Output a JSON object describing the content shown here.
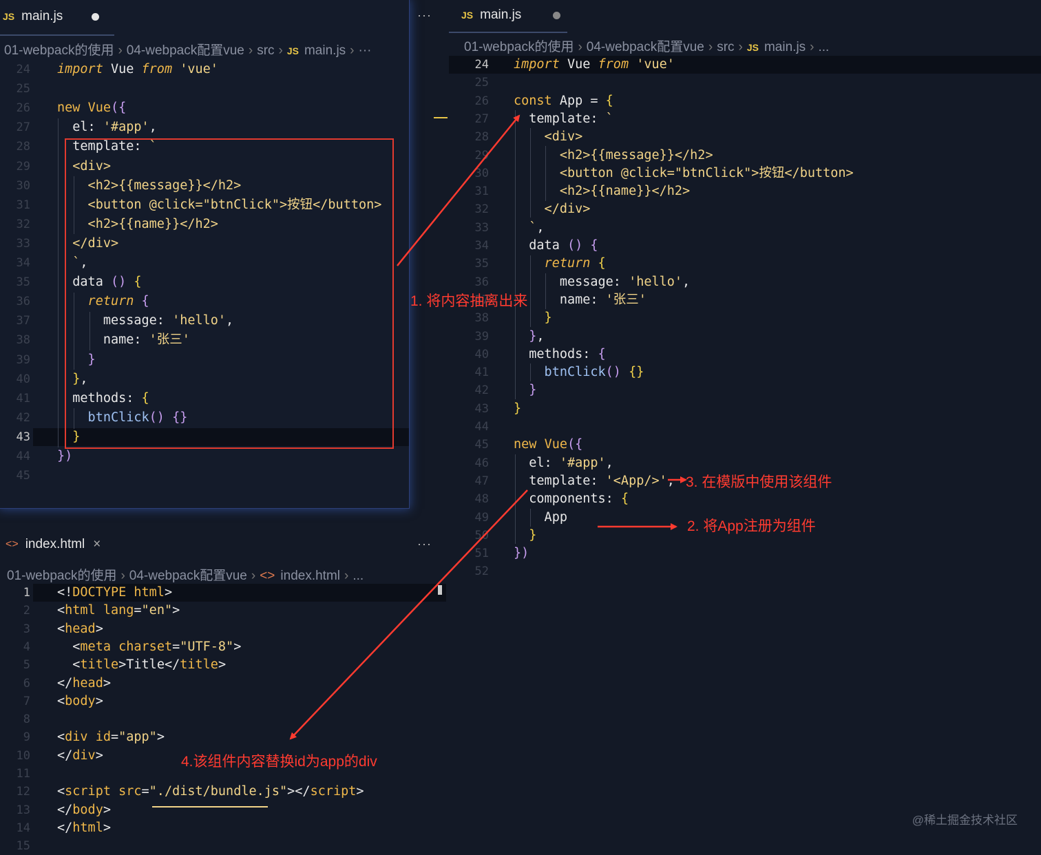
{
  "left_editor": {
    "tab": {
      "icon": "JS",
      "label": "main.js"
    },
    "more": "···",
    "breadcrumb": {
      "folder1": "01-webpack的使用",
      "folder2": "04-webpack配置vue",
      "folder3": "src",
      "icon": "JS",
      "file": "main.js",
      "tail": "···"
    }
  },
  "right_editor": {
    "tab": {
      "icon": "JS",
      "label": "main.js"
    },
    "breadcrumb": {
      "folder1": "01-webpack的使用",
      "folder2": "04-webpack配置vue",
      "folder3": "src",
      "icon": "JS",
      "file": "main.js",
      "tail": "..."
    }
  },
  "index_editor": {
    "tab": {
      "icon": "<>",
      "label": "index.html",
      "close": "×"
    },
    "more": "···",
    "breadcrumb": {
      "folder1": "01-webpack的使用",
      "folder2": "04-webpack配置vue",
      "icon": "<>",
      "file": "index.html",
      "tail": "..."
    }
  },
  "annotations": {
    "a1": "1. 将内容抽离出来",
    "a2": "2. 将App注册为组件",
    "a3": "3. 在模版中使用该组件",
    "a4": "4.该组件内容替换id为app的div"
  },
  "watermark": "@稀土掘金技术社区",
  "left_code": [
    {
      "n": "24",
      "t": [
        [
          "k-i",
          "import"
        ],
        [
          "w",
          " Vue "
        ],
        [
          "k-i",
          "from"
        ],
        [
          "w",
          " "
        ],
        [
          "s",
          "'vue'"
        ]
      ]
    },
    {
      "n": "25",
      "t": []
    },
    {
      "n": "26",
      "t": [
        [
          "k",
          "new"
        ],
        [
          "w",
          " "
        ],
        [
          "fn",
          "Vue"
        ],
        [
          "pb",
          "({"
        ]
      ]
    },
    {
      "n": "27",
      "t": [
        [
          "w",
          "  el: "
        ],
        [
          "s",
          "'#app'"
        ],
        [
          "w",
          ","
        ]
      ]
    },
    {
      "n": "28",
      "t": [
        [
          "w",
          "  template: "
        ],
        [
          "s",
          "`"
        ]
      ]
    },
    {
      "n": "29",
      "t": [
        [
          "s",
          "  <div>"
        ]
      ]
    },
    {
      "n": "30",
      "t": [
        [
          "s",
          "    <h2>{{message}}</h2>"
        ]
      ]
    },
    {
      "n": "31",
      "t": [
        [
          "s",
          "    <button @click=\"btnClick\">按钮</button>"
        ]
      ]
    },
    {
      "n": "32",
      "t": [
        [
          "s",
          "    <h2>{{name}}</h2>"
        ]
      ]
    },
    {
      "n": "33",
      "t": [
        [
          "s",
          "  </div>"
        ]
      ]
    },
    {
      "n": "34",
      "t": [
        [
          "s",
          "  `"
        ],
        [
          "w",
          ","
        ]
      ]
    },
    {
      "n": "35",
      "t": [
        [
          "w",
          "  data "
        ],
        [
          "pb",
          "()"
        ],
        [
          "w",
          " "
        ],
        [
          "py",
          "{"
        ]
      ]
    },
    {
      "n": "36",
      "t": [
        [
          "k-i",
          "    return"
        ],
        [
          "w",
          " "
        ],
        [
          "pb",
          "{"
        ]
      ]
    },
    {
      "n": "37",
      "t": [
        [
          "w",
          "      message: "
        ],
        [
          "s",
          "'hello'"
        ],
        [
          "w",
          ","
        ]
      ]
    },
    {
      "n": "38",
      "t": [
        [
          "w",
          "      name: "
        ],
        [
          "s",
          "'张三'"
        ]
      ]
    },
    {
      "n": "39",
      "t": [
        [
          "pb",
          "    }"
        ]
      ]
    },
    {
      "n": "40",
      "t": [
        [
          "py",
          "  }"
        ],
        [
          "w",
          ","
        ]
      ]
    },
    {
      "n": "41",
      "t": [
        [
          "w",
          "  methods: "
        ],
        [
          "py",
          "{"
        ]
      ]
    },
    {
      "n": "42",
      "t": [
        [
          "mth",
          "    btnClick"
        ],
        [
          "pb",
          "()"
        ],
        [
          "w",
          " "
        ],
        [
          "pb",
          "{}"
        ]
      ]
    },
    {
      "n": "43",
      "t": [
        [
          "py",
          "  }"
        ]
      ]
    },
    {
      "n": "44",
      "t": [
        [
          "pb",
          "})"
        ]
      ]
    },
    {
      "n": "45",
      "t": []
    }
  ],
  "right_code": [
    {
      "n": "24",
      "t": [
        [
          "k-i",
          "import"
        ],
        [
          "w",
          " Vue "
        ],
        [
          "k-i",
          "from"
        ],
        [
          "w",
          " "
        ],
        [
          "s",
          "'vue'"
        ]
      ]
    },
    {
      "n": "25",
      "t": []
    },
    {
      "n": "26",
      "t": [
        [
          "k",
          "const"
        ],
        [
          "w",
          " App = "
        ],
        [
          "py",
          "{"
        ]
      ]
    },
    {
      "n": "27",
      "t": [
        [
          "w",
          "  template: "
        ],
        [
          "s",
          "`"
        ]
      ]
    },
    {
      "n": "28",
      "t": [
        [
          "s",
          "    <div>"
        ]
      ]
    },
    {
      "n": "29",
      "t": [
        [
          "s",
          "      <h2>{{message}}</h2>"
        ]
      ]
    },
    {
      "n": "30",
      "t": [
        [
          "s",
          "      <button @click=\"btnClick\">按钮</button>"
        ]
      ]
    },
    {
      "n": "31",
      "t": [
        [
          "s",
          "      <h2>{{name}}</h2>"
        ]
      ]
    },
    {
      "n": "32",
      "t": [
        [
          "s",
          "    </div>"
        ]
      ]
    },
    {
      "n": "33",
      "t": [
        [
          "s",
          "  `"
        ],
        [
          "w",
          ","
        ]
      ]
    },
    {
      "n": "34",
      "t": [
        [
          "w",
          "  data "
        ],
        [
          "pb",
          "()"
        ],
        [
          "w",
          " "
        ],
        [
          "pb",
          "{"
        ]
      ]
    },
    {
      "n": "35",
      "t": [
        [
          "k-i",
          "    return"
        ],
        [
          "w",
          " "
        ],
        [
          "py",
          "{"
        ]
      ]
    },
    {
      "n": "36",
      "t": [
        [
          "w",
          "      message: "
        ],
        [
          "s",
          "'hello'"
        ],
        [
          "w",
          ","
        ]
      ]
    },
    {
      "n": "37",
      "t": [
        [
          "w",
          "      name: "
        ],
        [
          "s",
          "'张三'"
        ]
      ]
    },
    {
      "n": "38",
      "t": [
        [
          "py",
          "    }"
        ]
      ]
    },
    {
      "n": "39",
      "t": [
        [
          "pb",
          "  }"
        ],
        [
          "w",
          ","
        ]
      ]
    },
    {
      "n": "40",
      "t": [
        [
          "w",
          "  methods: "
        ],
        [
          "pb",
          "{"
        ]
      ]
    },
    {
      "n": "41",
      "t": [
        [
          "mth",
          "    btnClick"
        ],
        [
          "pb",
          "()"
        ],
        [
          "w",
          " "
        ],
        [
          "py",
          "{}"
        ]
      ]
    },
    {
      "n": "42",
      "t": [
        [
          "pb",
          "  }"
        ]
      ]
    },
    {
      "n": "43",
      "t": [
        [
          "py",
          "}"
        ]
      ]
    },
    {
      "n": "44",
      "t": []
    },
    {
      "n": "45",
      "t": [
        [
          "k",
          "new"
        ],
        [
          "w",
          " "
        ],
        [
          "fn",
          "Vue"
        ],
        [
          "pb",
          "({"
        ]
      ]
    },
    {
      "n": "46",
      "t": [
        [
          "w",
          "  el: "
        ],
        [
          "s",
          "'#app'"
        ],
        [
          "w",
          ","
        ]
      ]
    },
    {
      "n": "47",
      "t": [
        [
          "w",
          "  template: "
        ],
        [
          "s",
          "'<App/>'"
        ],
        [
          "w",
          ","
        ]
      ]
    },
    {
      "n": "48",
      "t": [
        [
          "w",
          "  components: "
        ],
        [
          "py",
          "{"
        ]
      ]
    },
    {
      "n": "49",
      "t": [
        [
          "w",
          "    App"
        ]
      ]
    },
    {
      "n": "50",
      "t": [
        [
          "py",
          "  }"
        ]
      ]
    },
    {
      "n": "51",
      "t": [
        [
          "pb",
          "})"
        ]
      ]
    },
    {
      "n": "52",
      "t": []
    }
  ],
  "index_code": [
    {
      "n": "1",
      "t": [
        [
          "w",
          "<!"
        ],
        [
          "tagc",
          "DOCTYPE"
        ],
        [
          "w",
          " "
        ],
        [
          "attr",
          "html"
        ],
        [
          "w",
          ">"
        ]
      ]
    },
    {
      "n": "2",
      "t": [
        [
          "w",
          "<"
        ],
        [
          "tagc",
          "html"
        ],
        [
          "w",
          " "
        ],
        [
          "attr",
          "lang"
        ],
        [
          "w",
          "="
        ],
        [
          "s",
          "\"en\""
        ],
        [
          "w",
          ">"
        ]
      ]
    },
    {
      "n": "3",
      "t": [
        [
          "w",
          "<"
        ],
        [
          "tagc",
          "head"
        ],
        [
          "w",
          ">"
        ]
      ]
    },
    {
      "n": "4",
      "t": [
        [
          "w",
          "  <"
        ],
        [
          "tagc",
          "meta"
        ],
        [
          "w",
          " "
        ],
        [
          "attr",
          "charset"
        ],
        [
          "w",
          "="
        ],
        [
          "s",
          "\"UTF-8\""
        ],
        [
          "w",
          ">"
        ]
      ]
    },
    {
      "n": "5",
      "t": [
        [
          "w",
          "  <"
        ],
        [
          "tagc",
          "title"
        ],
        [
          "w",
          ">Title</"
        ],
        [
          "tagc",
          "title"
        ],
        [
          "w",
          ">"
        ]
      ]
    },
    {
      "n": "6",
      "t": [
        [
          "w",
          "</"
        ],
        [
          "tagc",
          "head"
        ],
        [
          "w",
          ">"
        ]
      ]
    },
    {
      "n": "7",
      "t": [
        [
          "w",
          "<"
        ],
        [
          "tagc",
          "body"
        ],
        [
          "w",
          ">"
        ]
      ]
    },
    {
      "n": "8",
      "t": []
    },
    {
      "n": "9",
      "t": [
        [
          "w",
          "<"
        ],
        [
          "tagc",
          "div"
        ],
        [
          "w",
          " "
        ],
        [
          "attr",
          "id"
        ],
        [
          "w",
          "="
        ],
        [
          "s",
          "\"app\""
        ],
        [
          "w",
          ">"
        ]
      ]
    },
    {
      "n": "10",
      "t": [
        [
          "w",
          "</"
        ],
        [
          "tagc",
          "div"
        ],
        [
          "w",
          ">"
        ]
      ]
    },
    {
      "n": "11",
      "t": []
    },
    {
      "n": "12",
      "t": [
        [
          "w",
          "<"
        ],
        [
          "tagc",
          "script"
        ],
        [
          "w",
          " "
        ],
        [
          "attr",
          "src"
        ],
        [
          "w",
          "="
        ],
        [
          "s",
          "\"./dist/bundle.js\""
        ],
        [
          "w",
          "></"
        ],
        [
          "tagc",
          "script"
        ],
        [
          "w",
          ">"
        ]
      ]
    },
    {
      "n": "13",
      "t": [
        [
          "w",
          "</"
        ],
        [
          "tagc",
          "body"
        ],
        [
          "w",
          ">"
        ]
      ]
    },
    {
      "n": "14",
      "t": [
        [
          "w",
          "</"
        ],
        [
          "tagc",
          "html"
        ],
        [
          "w",
          ">"
        ]
      ]
    },
    {
      "n": "15",
      "t": []
    }
  ]
}
